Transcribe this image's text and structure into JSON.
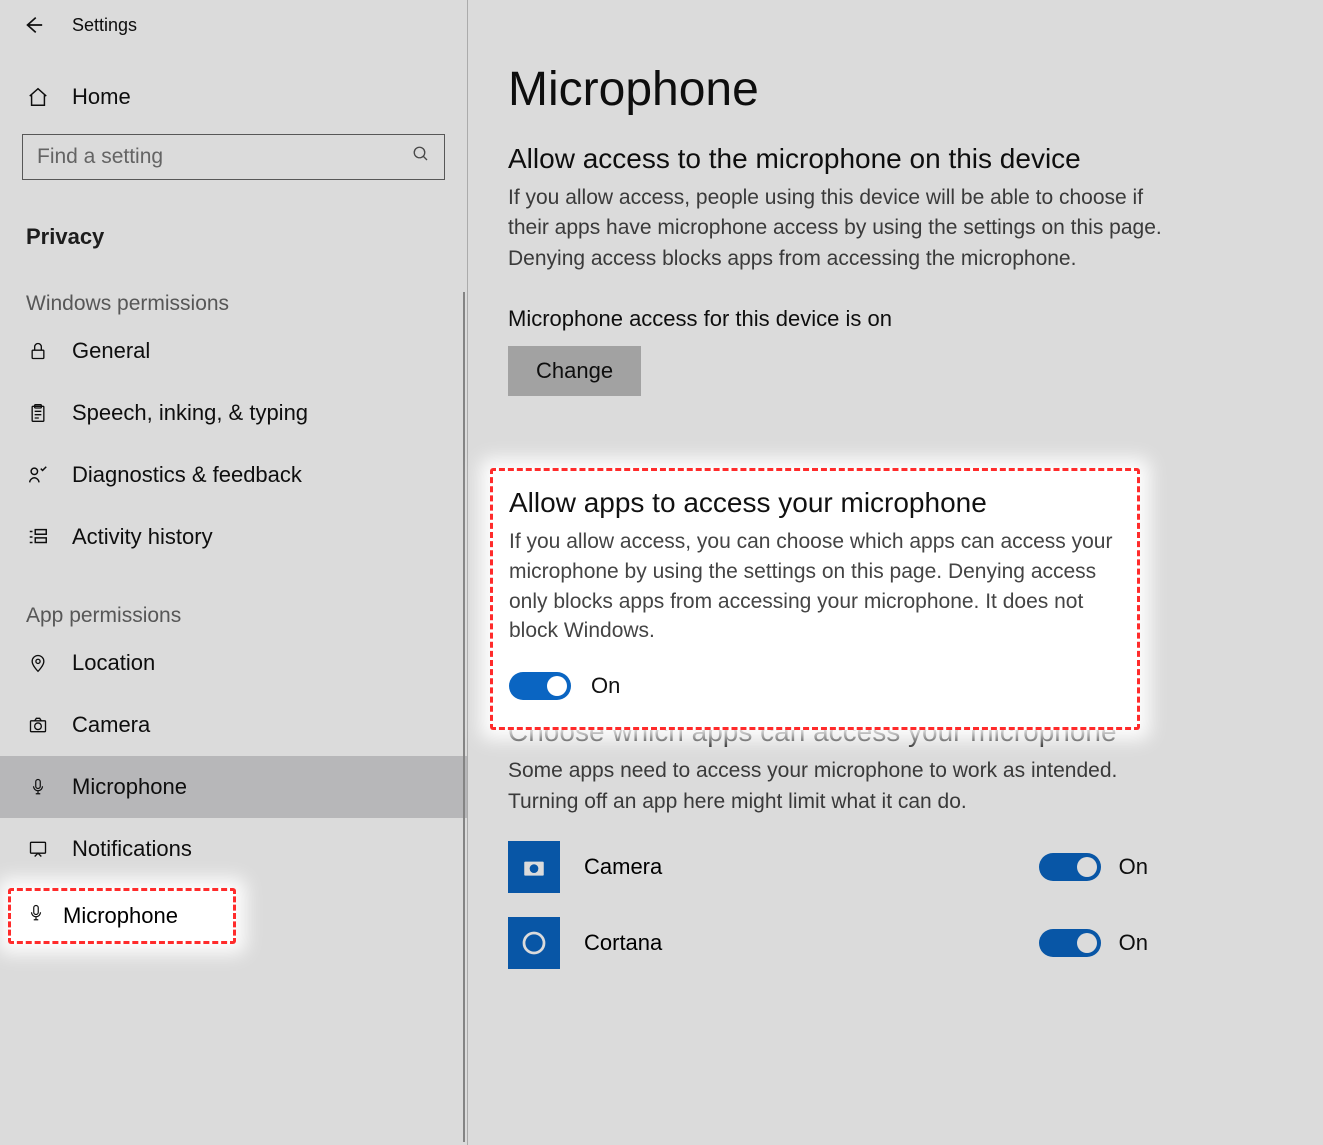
{
  "titlebar": {
    "app_name": "Settings"
  },
  "sidebar": {
    "home_label": "Home",
    "search_placeholder": "Find a setting",
    "privacy_label": "Privacy",
    "group_windows": "Windows permissions",
    "group_app": "App permissions",
    "items_win": [
      {
        "label": "General"
      },
      {
        "label": "Speech, inking, & typing"
      },
      {
        "label": "Diagnostics & feedback"
      },
      {
        "label": "Activity history"
      }
    ],
    "items_app": [
      {
        "label": "Location"
      },
      {
        "label": "Camera"
      },
      {
        "label": "Microphone"
      },
      {
        "label": "Notifications"
      }
    ]
  },
  "main": {
    "title": "Microphone",
    "section1_title": "Allow access to the microphone on this device",
    "section1_body": "If you allow access, people using this device will be able to choose if their apps have microphone access by using the settings on this page. Denying access blocks apps from accessing the microphone.",
    "status_line": "Microphone access for this device is on",
    "change_label": "Change",
    "section2_title": "Allow apps to access your microphone",
    "section2_body": "If you allow access, you can choose which apps can access your microphone by using the settings on this page. Denying access only blocks apps from accessing your microphone. It does not block Windows.",
    "section2_toggle": "On",
    "section3_title": "Choose which apps can access your microphone",
    "section3_body": "Some apps need to access your microphone to work as intended. Turning off an app here might limit what it can do.",
    "apps": [
      {
        "name": "Camera",
        "state": "On"
      },
      {
        "name": "Cortana",
        "state": "On"
      }
    ]
  }
}
